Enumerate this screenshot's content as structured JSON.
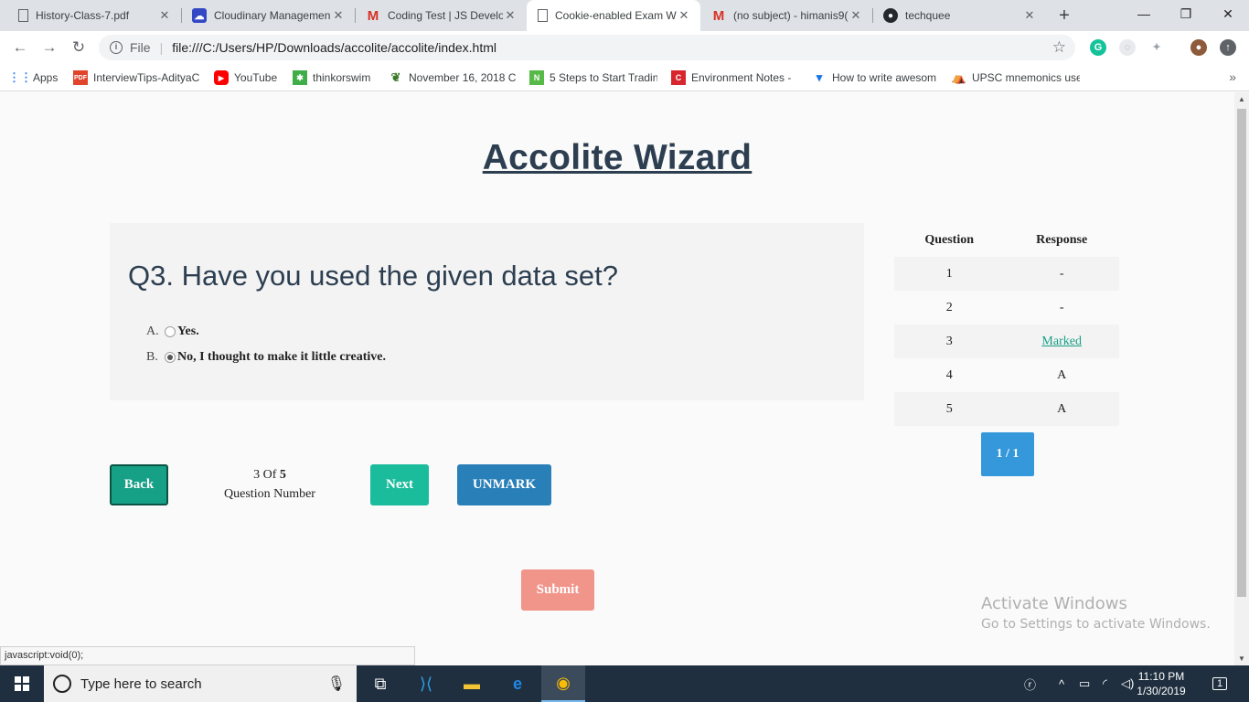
{
  "browser": {
    "tabs": [
      {
        "title": "History-Class-7.pdf",
        "icon": "document-icon"
      },
      {
        "title": "Cloudinary Managemen",
        "icon": "cloudinary-icon"
      },
      {
        "title": "Coding Test | JS Develo",
        "icon": "gmail-icon"
      },
      {
        "title": "Cookie-enabled Exam W",
        "icon": "page-icon",
        "active": true
      },
      {
        "title": "(no subject) - himanis9(",
        "icon": "gmail-icon"
      },
      {
        "title": "techquee",
        "icon": "github-icon"
      }
    ],
    "address": {
      "scheme": "File",
      "url": "file:///C:/Users/HP/Downloads/accolite/accolite/index.html"
    },
    "bookmarks": [
      {
        "label": "Apps",
        "icon": "apps-grid-icon"
      },
      {
        "label": "InterviewTips-AdityaC",
        "icon": "pdf-icon"
      },
      {
        "label": "YouTube",
        "icon": "youtube-icon"
      },
      {
        "label": "thinkorswim",
        "icon": "thinkorswim-icon"
      },
      {
        "label": "November 16, 2018 C",
        "icon": "plant-icon"
      },
      {
        "label": "5 Steps to Start Tradin",
        "icon": "n-logo-icon"
      },
      {
        "label": "Environment Notes -",
        "icon": "c-logo-icon"
      },
      {
        "label": "How to write awesom",
        "icon": "funnel-icon"
      },
      {
        "label": "UPSC mnemonics use",
        "icon": "tent-icon"
      }
    ],
    "status_text": "javascript:void(0);"
  },
  "page": {
    "title": "Accolite Wizard",
    "question": {
      "text": "Q3. Have you used the given data set?",
      "options": [
        {
          "letter": "A.",
          "text": "Yes.",
          "selected": false
        },
        {
          "letter": "B.",
          "text": "No, I thought to make it little creative.",
          "selected": true
        }
      ]
    },
    "nav": {
      "back": "Back",
      "counter_current": "3 Of",
      "counter_total": "5",
      "counter_label": "Question Number",
      "next": "Next",
      "unmark": "UNMARK",
      "submit": "Submit"
    },
    "responses": {
      "headers": [
        "Question",
        "Response"
      ],
      "rows": [
        {
          "q": "1",
          "r": "-"
        },
        {
          "q": "2",
          "r": "-"
        },
        {
          "q": "3",
          "r": "Marked",
          "link": true
        },
        {
          "q": "4",
          "r": "A"
        },
        {
          "q": "5",
          "r": "A"
        }
      ],
      "pager": "1 / 1"
    },
    "watermark": {
      "line1": "Activate Windows",
      "line2": "Go to Settings to activate Windows."
    }
  },
  "taskbar": {
    "search_placeholder": "Type here to search",
    "time": "11:10 PM",
    "date": "1/30/2019",
    "notification_count": "1"
  },
  "colors": {
    "title": "#2c3e50",
    "back": "#16a085",
    "next": "#1abc9c",
    "unmark": "#2980b9",
    "submit": "#f1948a",
    "pager": "#3498db"
  }
}
